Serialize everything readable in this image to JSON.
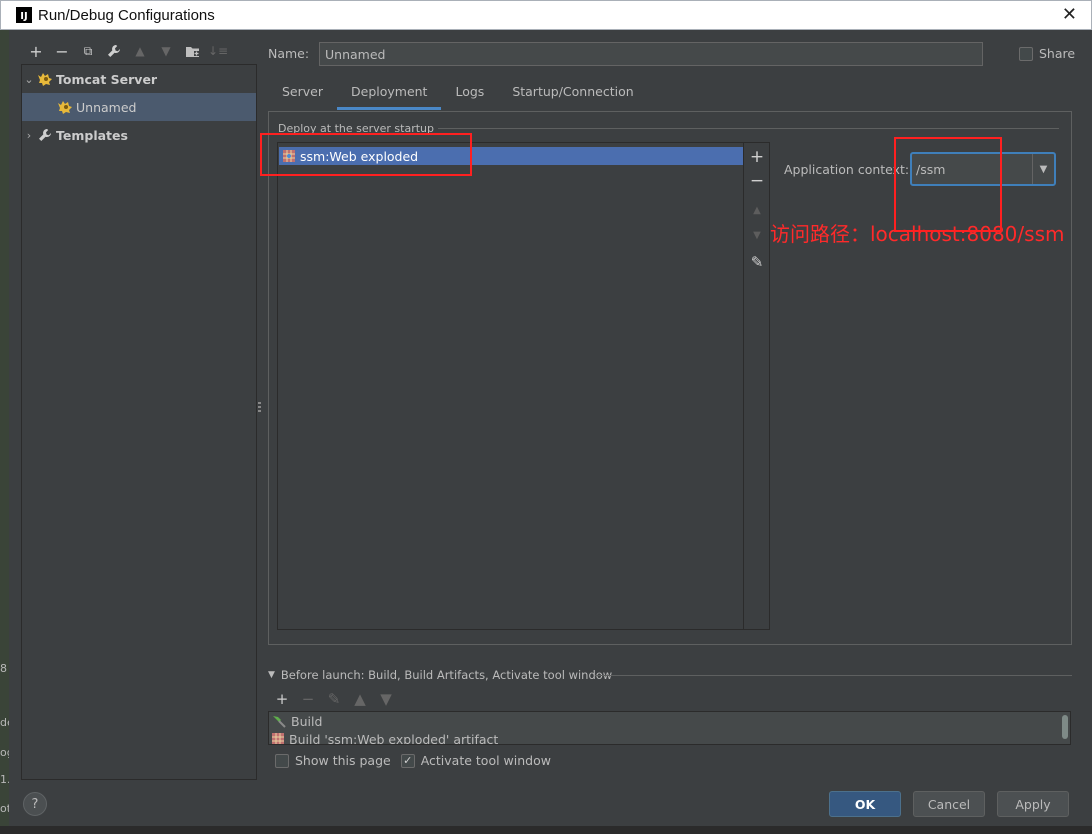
{
  "window": {
    "title": "Run/Debug Configurations",
    "logo_text": "IJ"
  },
  "background_fragments": [
    "8",
    "de",
    "og",
    "1.",
    "ot"
  ],
  "toolbar": {
    "add": "+",
    "remove": "−",
    "copy": "⧉",
    "edit": "🔧",
    "up": "▲",
    "down": "▼",
    "folder": "▆",
    "sort": "↓≡"
  },
  "tree": {
    "items": [
      {
        "label": "Tomcat Server",
        "arrow": "⌄"
      },
      {
        "label": "Unnamed"
      },
      {
        "label": "Templates",
        "arrow": "›"
      }
    ]
  },
  "name": {
    "label": "Name:",
    "value": "Unnamed"
  },
  "share": {
    "label": "Share"
  },
  "tabs": [
    {
      "label": "Server"
    },
    {
      "label": "Deployment"
    },
    {
      "label": "Logs"
    },
    {
      "label": "Startup/Connection"
    }
  ],
  "deployment": {
    "section_title": "Deploy at the server startup",
    "artifacts": [
      "ssm:Web exploded"
    ],
    "tools": {
      "add": "+",
      "remove": "−",
      "up": "▲",
      "down": "▼",
      "edit": "✎"
    },
    "context_label": "Application context:",
    "context_value": "/ssm"
  },
  "annotation": "访问路径：localhost:8080/ssm",
  "before_launch": {
    "header": "Before launch: Build, Build Artifacts, Activate tool window",
    "items": [
      "Build",
      "Build 'ssm:Web exploded' artifact"
    ]
  },
  "options": {
    "show_page": "Show this page",
    "activate_tool": "Activate tool window"
  },
  "buttons": {
    "help": "?",
    "ok": "OK",
    "cancel": "Cancel",
    "apply": "Apply"
  },
  "colors": {
    "accent": "#4a88c7",
    "selection": "#4b6eaf",
    "ok_button": "#365880",
    "annotation": "#ff2a2a"
  }
}
